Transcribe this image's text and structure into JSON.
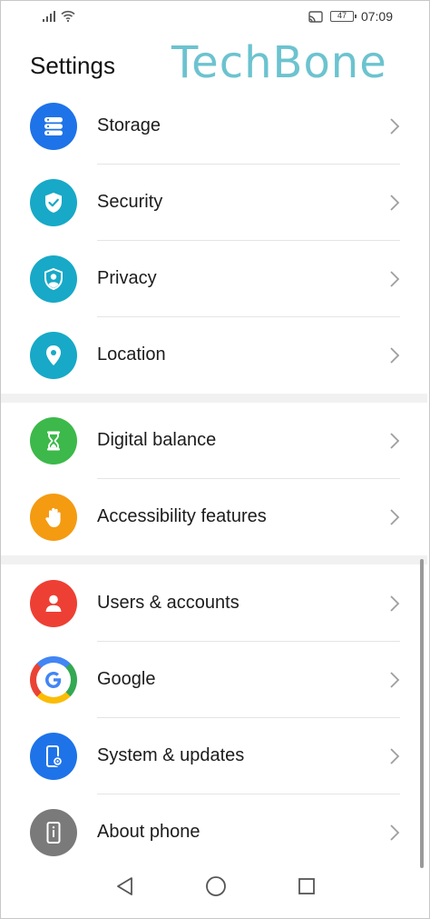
{
  "status_bar": {
    "time": "07:09",
    "battery_level": "47",
    "icons": [
      "signal-icon",
      "wifi-icon",
      "cast-icon",
      "battery-icon"
    ]
  },
  "header": {
    "title": "Settings",
    "watermark": "TechBone"
  },
  "groups": [
    {
      "items": [
        {
          "label": "Storage",
          "icon": "storage-icon",
          "color": "#1e73e8"
        },
        {
          "label": "Security",
          "icon": "shield-check-icon",
          "color": "#17a9c7"
        },
        {
          "label": "Privacy",
          "icon": "privacy-user-shield-icon",
          "color": "#17a9c7"
        },
        {
          "label": "Location",
          "icon": "location-pin-icon",
          "color": "#17a9c7"
        }
      ]
    },
    {
      "items": [
        {
          "label": "Digital balance",
          "icon": "hourglass-icon",
          "color": "#3cb94a"
        },
        {
          "label": "Accessibility features",
          "icon": "hand-icon",
          "color": "#f49b12"
        }
      ]
    },
    {
      "items": [
        {
          "label": "Users & accounts",
          "icon": "user-icon",
          "color": "#ee3f34"
        },
        {
          "label": "Google",
          "icon": "google-icon",
          "color": "#ffffff"
        },
        {
          "label": "System & updates",
          "icon": "phone-gear-icon",
          "color": "#1e73e8"
        },
        {
          "label": "About phone",
          "icon": "phone-info-icon",
          "color": "#7a7a7a"
        }
      ]
    }
  ],
  "nav": {
    "icons": [
      "back-icon",
      "home-icon",
      "recents-icon"
    ]
  }
}
